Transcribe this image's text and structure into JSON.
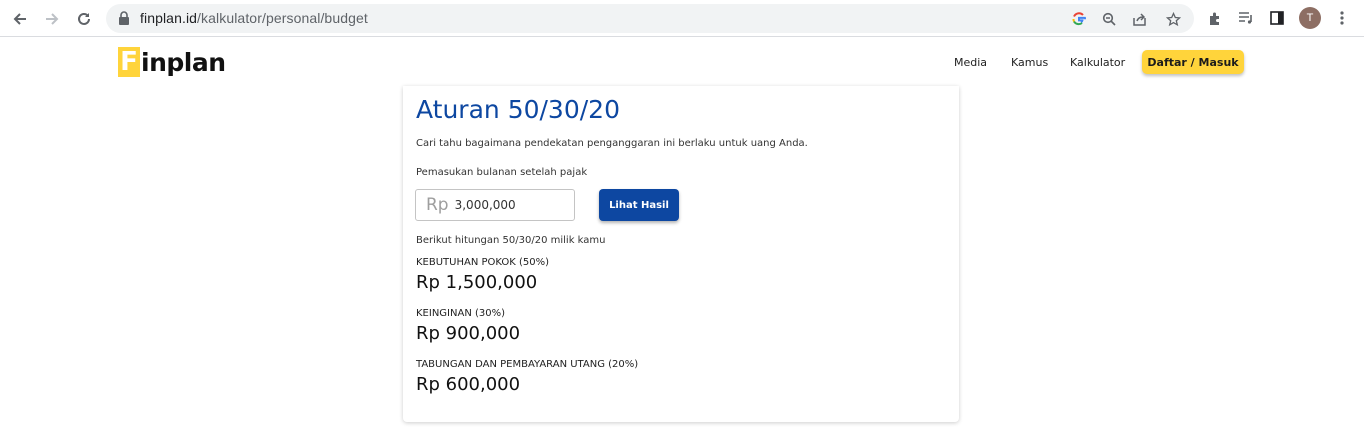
{
  "browser": {
    "url_host": "finplan.id",
    "url_path": "/kalkulator/personal/budget",
    "profile_initial": "T"
  },
  "site": {
    "logo_letter": "F",
    "logo_rest": "inplan",
    "nav": [
      "Media",
      "Kamus",
      "Kalkulator"
    ],
    "cta_label": "Daftar / Masuk",
    "accent_color": "#ffd43b",
    "primary_color": "#0d47a1"
  },
  "calculator": {
    "title": "Aturan 50/30/20",
    "description": "Cari tahu bagaimana pendekatan penganggaran ini berlaku untuk uang Anda.",
    "income_label": "Pemasukan bulanan setelah pajak",
    "currency_prefix": "Rp",
    "income_value": "3,000,000",
    "submit_label": "Lihat Hasil",
    "result_intro": "Berikut hitungan 50/30/20 milik kamu",
    "results": [
      {
        "label": "KEBUTUHAN POKOK (50%)",
        "value": "Rp 1,500,000"
      },
      {
        "label": "KEINGINAN (30%)",
        "value": "Rp 900,000"
      },
      {
        "label": "TABUNGAN DAN PEMBAYARAN UTANG (20%)",
        "value": "Rp 600,000"
      }
    ]
  }
}
